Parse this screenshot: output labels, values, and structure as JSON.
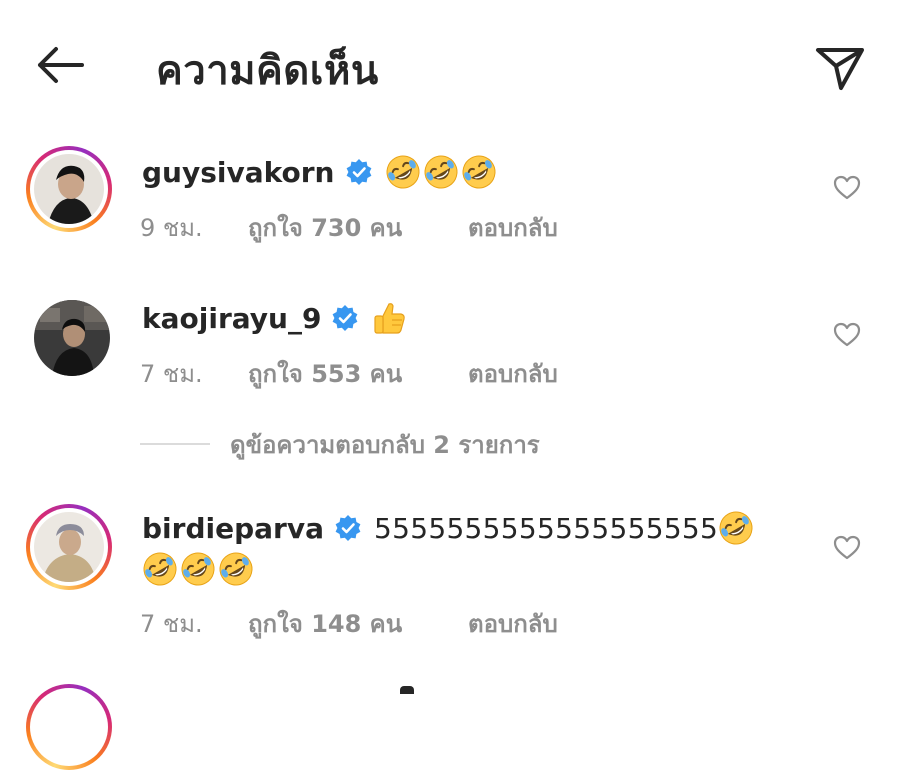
{
  "header": {
    "title": "ความคิดเห็น",
    "back_icon": "arrow-left-icon",
    "send_icon": "paper-plane-icon"
  },
  "colors": {
    "text": "#262626",
    "muted": "#8e8e8e",
    "verified": "#3897f0",
    "divider": "#dbdbdb"
  },
  "comments": [
    {
      "username": "guysivakorn",
      "verified": true,
      "text": "",
      "emojis": [
        "rofl",
        "rofl",
        "rofl"
      ],
      "time": "9 ชม.",
      "likes": "ถูกใจ 730 คน",
      "reply": "ตอบกลับ",
      "has_story_ring": true
    },
    {
      "username": "kaojirayu_9",
      "verified": true,
      "text": "",
      "emojis": [
        "thumbs-up"
      ],
      "time": "7 ชม.",
      "likes": "ถูกใจ 553 คน",
      "reply": "ตอบกลับ",
      "has_story_ring": false
    },
    {
      "username": "birdieparva",
      "verified": true,
      "text": "5555555555555555555",
      "emojis": [
        "rofl",
        "rofl",
        "rofl",
        "rofl"
      ],
      "time": "7 ชม.",
      "likes": "ถูกใจ 148 คน",
      "reply": "ตอบกลับ",
      "has_story_ring": true
    }
  ],
  "view_replies": "ดูข้อความตอบกลับ 2 รายการ"
}
